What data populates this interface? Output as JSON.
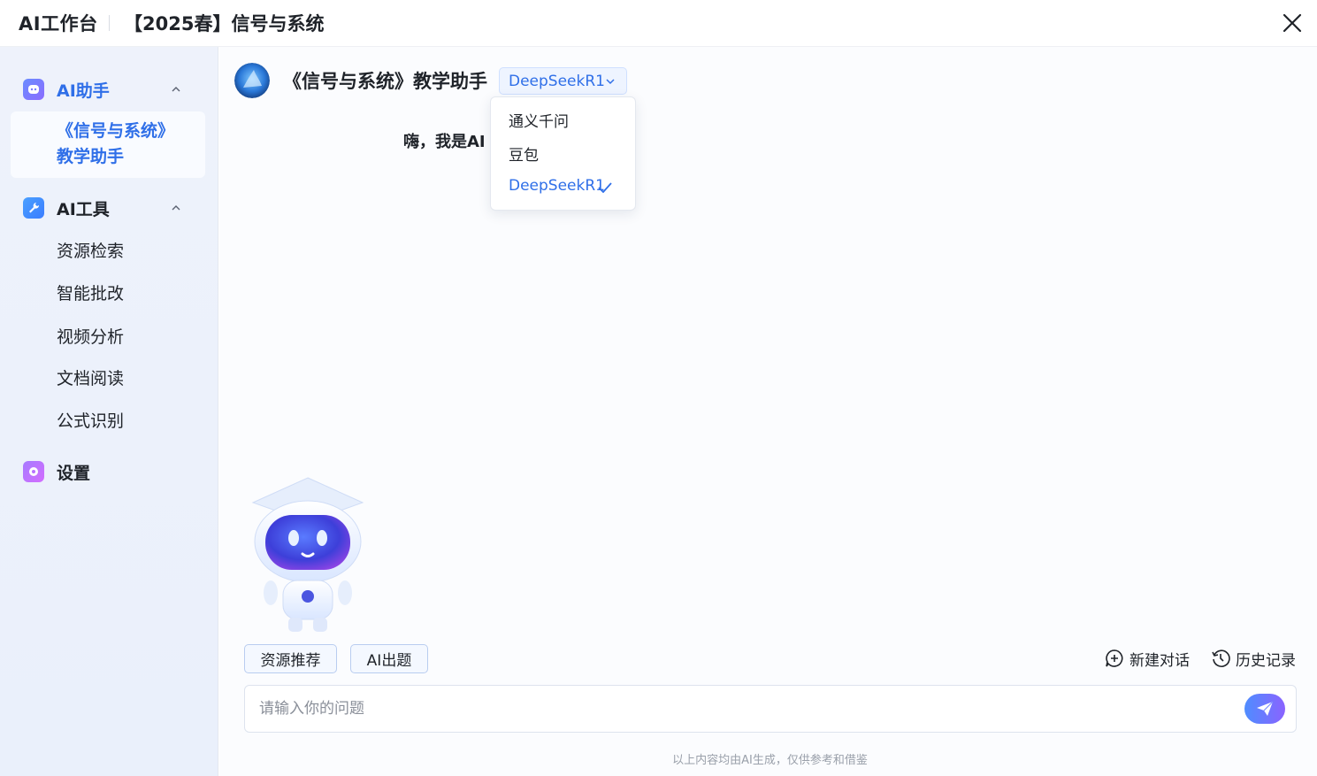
{
  "header": {
    "app_title": "AI工作台",
    "course_title": "【2025春】信号与系统"
  },
  "sidebar": {
    "ai_assistant": {
      "label": "AI助手",
      "active_item": "《信号与系统》教学助手"
    },
    "ai_tools": {
      "label": "AI工具",
      "items": [
        "资源检索",
        "智能批改",
        "视频分析",
        "文档阅读",
        "公式识别"
      ]
    },
    "settings": {
      "label": "设置"
    }
  },
  "main": {
    "assistant_title": "《信号与系统》教学助手",
    "model_selected": "DeepSeekR1",
    "model_options": [
      "通义千问",
      "豆包",
      "DeepSeekR1"
    ],
    "greeting": "嗨，我是AI",
    "chips": [
      "资源推荐",
      "AI出题"
    ],
    "new_chat_label": "新建对话",
    "history_label": "历史记录",
    "input_placeholder": "请输入你的问题",
    "disclaimer": "以上内容均由AI生成，仅供参考和借鉴"
  },
  "colors": {
    "accent": "#2f6fe8",
    "sidebar_bg": "#eef2fb",
    "send_gradient_start": "#4f8dff",
    "send_gradient_end": "#8a63ff"
  }
}
